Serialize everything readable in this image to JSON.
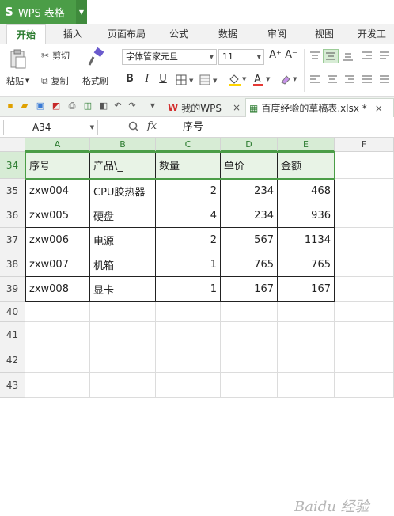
{
  "app": {
    "logo": "S",
    "title": "WPS 表格"
  },
  "tabs": [
    "开始",
    "插入",
    "页面布局",
    "公式",
    "数据",
    "审阅",
    "视图",
    "开发工具"
  ],
  "ribbon": {
    "cut": "剪切",
    "paste": "粘贴",
    "copy": "复制",
    "format_painter": "格式刷",
    "font_name": "字体管家元旦",
    "font_size": "11",
    "bold": "B",
    "italic": "I",
    "underline": "U",
    "grow": "A⁺",
    "shrink": "A⁻"
  },
  "doc_tabs": {
    "home": "我的WPS",
    "file": "百度经验的草稿表.xlsx *"
  },
  "formula_bar": {
    "cell_ref": "A34",
    "fx": "fx",
    "content": "序号"
  },
  "columns": [
    "A",
    "B",
    "C",
    "D",
    "E",
    "F"
  ],
  "rows": [
    {
      "num": "34",
      "cells": [
        "序号",
        "产品\\_",
        "数量",
        "单价",
        "金额"
      ],
      "header": true
    },
    {
      "num": "35",
      "cells": [
        "zxw004",
        "CPU胶热器",
        "2",
        "234",
        "468"
      ]
    },
    {
      "num": "36",
      "cells": [
        "zxw005",
        "硬盘",
        "4",
        "234",
        "936"
      ]
    },
    {
      "num": "37",
      "cells": [
        "zxw006",
        "电源",
        "2",
        "567",
        "1134"
      ]
    },
    {
      "num": "38",
      "cells": [
        "zxw007",
        "机箱",
        "1",
        "765",
        "765"
      ]
    },
    {
      "num": "39",
      "cells": [
        "zxw008",
        "显卡",
        "1",
        "167",
        "167"
      ]
    },
    {
      "num": "40",
      "cells": [
        "",
        "",
        "",
        "",
        ""
      ]
    },
    {
      "num": "41",
      "cells": [
        "",
        "",
        "",
        "",
        ""
      ]
    },
    {
      "num": "42",
      "cells": [
        "",
        "",
        "",
        "",
        ""
      ]
    },
    {
      "num": "43",
      "cells": [
        "",
        "",
        "",
        "",
        ""
      ]
    }
  ],
  "watermark": "Baidu 经验",
  "colors": {
    "accent": "#4b9d47",
    "header_fill": "#e8f3e6"
  }
}
